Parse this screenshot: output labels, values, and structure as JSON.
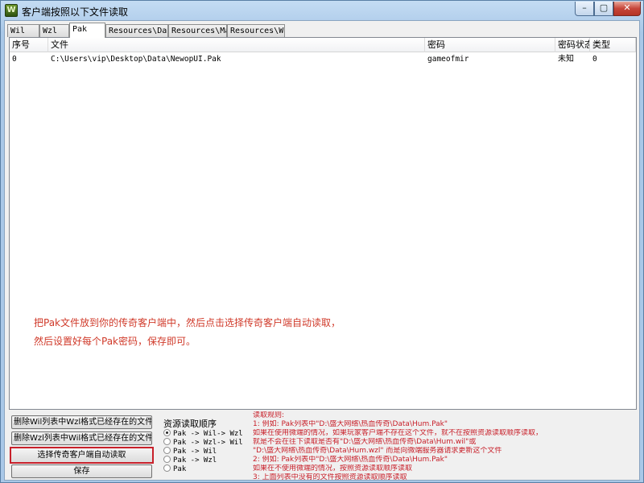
{
  "window": {
    "title": "客户端按照以下文件读取",
    "icon_label": "W",
    "minimize_glyph": "–",
    "maximize_glyph": "▢",
    "close_glyph": "✕"
  },
  "tabs": [
    "Wil",
    "Wzl",
    "Pak",
    "Resources\\Data",
    "Resources\\Map",
    "Resources\\Wav"
  ],
  "active_tab": "Pak",
  "table": {
    "columns": [
      "序号",
      "文件",
      "密码",
      "密码状态",
      "类型"
    ],
    "rows": [
      [
        "0",
        "C:\\Users\\vip\\Desktop\\Data\\NewopUI.Pak",
        "gameofmir",
        "未知",
        "0"
      ]
    ]
  },
  "hint": {
    "line1": "把Pak文件放到你的传奇客户端中，然后点击选择传奇客户端自动读取，",
    "line2": "然后设置好每个Pak密码，保存即可。"
  },
  "buttons": {
    "delete_wil": "删除Wil列表中Wzl格式已经存在的文件",
    "delete_wzl": "删除Wzl列表中Wil格式已经存在的文件",
    "auto_read": "选择传奇客户端自动读取",
    "save": "保存"
  },
  "read_order": {
    "title": "资源读取顺序",
    "options": [
      "Pak -> Wil-> Wzl",
      "Pak -> Wzl-> Wil",
      "Pak -> Wil",
      "Pak -> Wzl",
      "Pak"
    ],
    "selected": 0
  },
  "rules": {
    "title": "读取规则:",
    "lines": [
      "1: 例如: Pak列表中\"D:\\盛大网络\\热血传奇\\Data\\Hum.Pak\"",
      "    如果在使用微端的情况，如果玩家客户端不存在这个文件，就不在按照资源读取顺序读取，",
      "    就是不会在往下读取是否有\"D:\\盛大网络\\热血传奇\\Data\\Hum.wil\"或",
      "    \"D:\\盛大网络\\热血传奇\\Data\\Hum.wzl\" 而是向微端服务器请求更新这个文件",
      "2: 例如: Pak列表中\"D:\\盛大网络\\热血传奇\\Data\\Hum.Pak\"",
      "    如果在不使用微端的情况，按照资源读取顺序读取",
      "3: 上面列表中没有的文件按照资源读取顺序读取"
    ]
  }
}
